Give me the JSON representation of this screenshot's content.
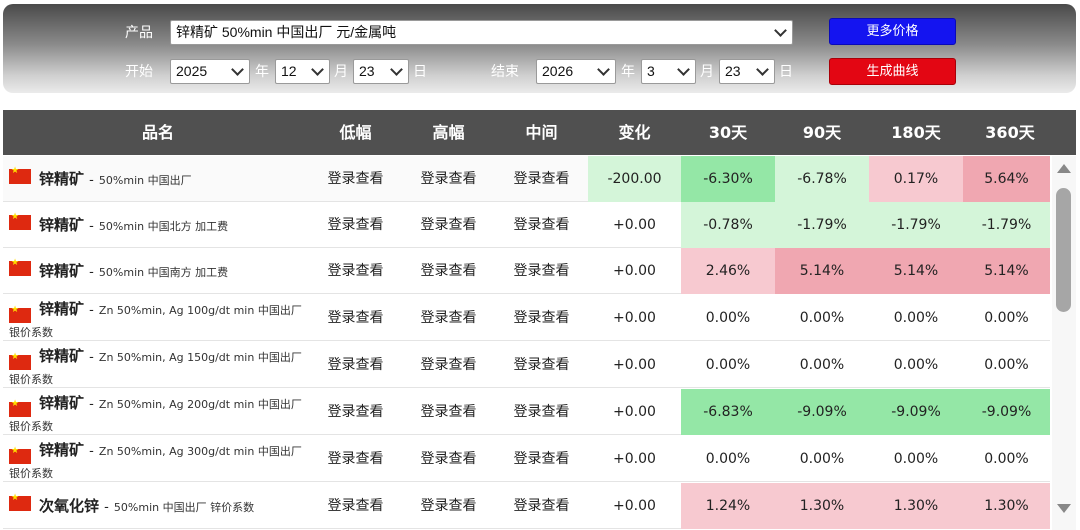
{
  "filter": {
    "product_label": "产品",
    "product_value": "锌精矿 50%min 中国出厂 元/金属吨",
    "start_label": "开始",
    "end_label": "结束",
    "start": {
      "year": "2025",
      "month": "12",
      "day": "23"
    },
    "end": {
      "year": "2026",
      "month": "3",
      "day": "23"
    },
    "unit_year": "年",
    "unit_month": "月",
    "unit_day": "日",
    "more_prices_button": "更多价格",
    "generate_curve_button": "生成曲线"
  },
  "table": {
    "headers": [
      "品名",
      "低幅",
      "高幅",
      "中间",
      "变化",
      "30天",
      "90天",
      "180天",
      "360天"
    ],
    "rows": [
      {
        "name": "锌精矿",
        "desc": "50%min 中国出厂",
        "low": "登录查看",
        "high": "登录查看",
        "mid": "登录查看",
        "change": "-200.00",
        "d30": "-6.30%",
        "d90": "-6.78%",
        "d180": "0.17%",
        "d360": "5.64%"
      },
      {
        "name": "锌精矿",
        "desc": "50%min 中国北方 加工费",
        "low": "登录查看",
        "high": "登录查看",
        "mid": "登录查看",
        "change": "+0.00",
        "d30": "-0.78%",
        "d90": "-1.79%",
        "d180": "-1.79%",
        "d360": "-1.79%"
      },
      {
        "name": "锌精矿",
        "desc": "50%min 中国南方 加工费",
        "low": "登录查看",
        "high": "登录查看",
        "mid": "登录查看",
        "change": "+0.00",
        "d30": "2.46%",
        "d90": "5.14%",
        "d180": "5.14%",
        "d360": "5.14%"
      },
      {
        "name": "锌精矿",
        "desc": "Zn 50%min, Ag 100g/dt min 中国出厂 银价系数",
        "low": "登录查看",
        "high": "登录查看",
        "mid": "登录查看",
        "change": "+0.00",
        "d30": "0.00%",
        "d90": "0.00%",
        "d180": "0.00%",
        "d360": "0.00%"
      },
      {
        "name": "锌精矿",
        "desc": "Zn 50%min, Ag 150g/dt min 中国出厂 银价系数",
        "low": "登录查看",
        "high": "登录查看",
        "mid": "登录查看",
        "change": "+0.00",
        "d30": "0.00%",
        "d90": "0.00%",
        "d180": "0.00%",
        "d360": "0.00%"
      },
      {
        "name": "锌精矿",
        "desc": "Zn 50%min, Ag 200g/dt min 中国出厂 银价系数",
        "low": "登录查看",
        "high": "登录查看",
        "mid": "登录查看",
        "change": "+0.00",
        "d30": "-6.83%",
        "d90": "-9.09%",
        "d180": "-9.09%",
        "d360": "-9.09%"
      },
      {
        "name": "锌精矿",
        "desc": "Zn 50%min, Ag 300g/dt min 中国出厂 银价系数",
        "low": "登录查看",
        "high": "登录查看",
        "mid": "登录查看",
        "change": "+0.00",
        "d30": "0.00%",
        "d90": "0.00%",
        "d180": "0.00%",
        "d360": "0.00%"
      },
      {
        "name": "次氧化锌",
        "desc": "50%min 中国出厂 锌价系数",
        "low": "登录查看",
        "high": "登录查看",
        "mid": "登录查看",
        "change": "+0.00",
        "d30": "1.24%",
        "d90": "1.30%",
        "d180": "1.30%",
        "d360": "1.30%"
      }
    ]
  },
  "colors": {
    "header_bg": "#505050",
    "button_blue": "#1414f0",
    "button_red": "#e30613",
    "green_light": "#d4f5d9",
    "green_medium": "#94e7a6",
    "red_light": "#f7c9d0",
    "red_medium": "#f0a7b1"
  },
  "icons": {
    "row_flag": "china-flag-icon",
    "scroll_up": "arrow-up-icon",
    "scroll_down": "arrow-down-icon"
  }
}
